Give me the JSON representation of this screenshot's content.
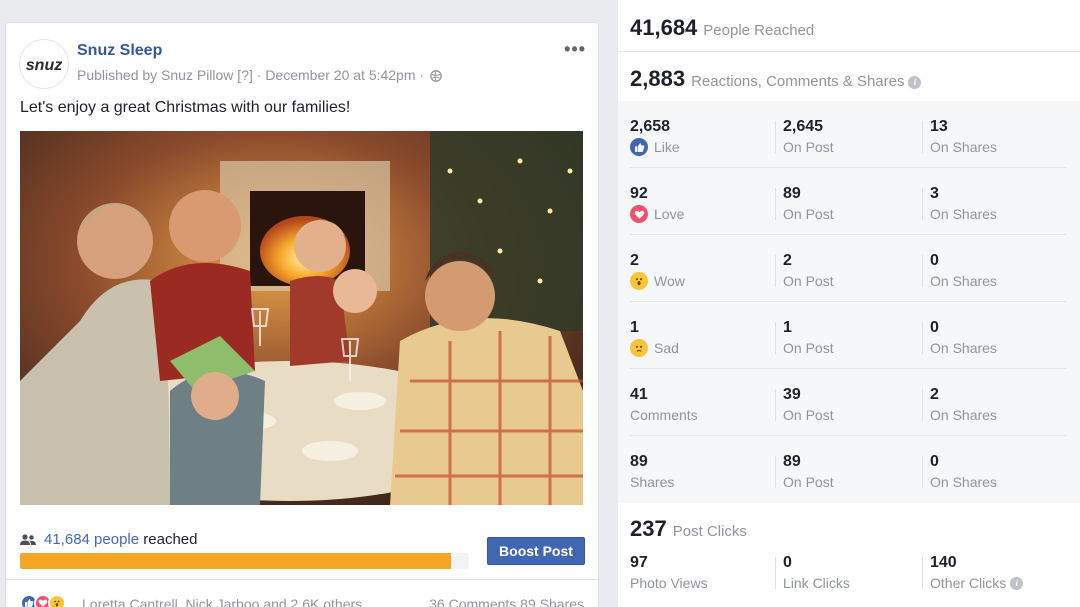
{
  "post": {
    "page_name": "Snuz Sleep",
    "avatar_text": "snuz",
    "published_by": "Published by Snuz Pillow [?] · December 20 at 5:42pm ·",
    "message": "Let's enjoy a great Christmas with our families!",
    "reach_count_link": "41,684 people",
    "reach_suffix": " reached",
    "reach_progress": 0.96,
    "boost_label": "Boost Post",
    "reactors": "Loretta Cantrell, Nick Jarboo and 2.6K others",
    "comments_shares": "36 Comments  89 Shares",
    "colors": {
      "link": "#4267b2",
      "bar": "#f5a623",
      "button": "#4267b2"
    }
  },
  "stats": {
    "reach": {
      "number": "41,684",
      "label": "People Reached"
    },
    "engagement": {
      "number": "2,883",
      "label": "Reactions, Comments & Shares"
    },
    "rows": [
      {
        "total": "2,658",
        "label": "Like",
        "icon": "like-icon",
        "on_post": "2,645",
        "on_post_label": "On Post",
        "on_shares": "13",
        "on_shares_label": "On Shares"
      },
      {
        "total": "92",
        "label": "Love",
        "icon": "love-icon",
        "on_post": "89",
        "on_post_label": "On Post",
        "on_shares": "3",
        "on_shares_label": "On Shares"
      },
      {
        "total": "2",
        "label": "Wow",
        "icon": "wow-icon",
        "on_post": "2",
        "on_post_label": "On Post",
        "on_shares": "0",
        "on_shares_label": "On Shares"
      },
      {
        "total": "1",
        "label": "Sad",
        "icon": "sad-icon",
        "on_post": "1",
        "on_post_label": "On Post",
        "on_shares": "0",
        "on_shares_label": "On Shares"
      },
      {
        "total": "41",
        "label": "Comments",
        "icon": "",
        "on_post": "39",
        "on_post_label": "On Post",
        "on_shares": "2",
        "on_shares_label": "On Shares"
      },
      {
        "total": "89",
        "label": "Shares",
        "icon": "",
        "on_post": "89",
        "on_post_label": "On Post",
        "on_shares": "0",
        "on_shares_label": "On Shares"
      }
    ],
    "clicks": {
      "number": "237",
      "label": "Post Clicks",
      "photo_views": "97",
      "photo_views_label": "Photo Views",
      "link_clicks": "0",
      "link_clicks_label": "Link Clicks",
      "other_clicks": "140",
      "other_clicks_label": "Other Clicks"
    }
  }
}
